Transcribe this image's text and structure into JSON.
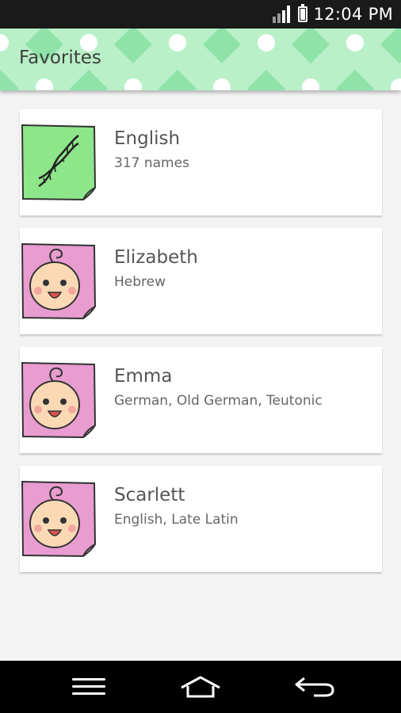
{
  "status_bar": {
    "time": "12:04 PM",
    "icons": [
      "signal-icon",
      "battery-icon"
    ]
  },
  "header": {
    "title": "Favorites",
    "colors": {
      "background": "#b9f0c8",
      "pattern": "#8fe3a8"
    }
  },
  "items": [
    {
      "title": "English",
      "subtitle": "317 names",
      "icon": "dna-icon",
      "thumb_color": "#8ee68a"
    },
    {
      "title": "Elizabeth",
      "subtitle": "Hebrew",
      "icon": "baby-face-icon",
      "thumb_color": "#e89cd0"
    },
    {
      "title": "Emma",
      "subtitle": "German, Old German, Teutonic",
      "icon": "baby-face-icon",
      "thumb_color": "#e89cd0"
    },
    {
      "title": "Scarlett",
      "subtitle": "English, Late Latin",
      "icon": "baby-face-icon",
      "thumb_color": "#e89cd0"
    }
  ],
  "nav_bar": {
    "buttons": [
      "menu-icon",
      "home-icon",
      "back-icon"
    ]
  }
}
